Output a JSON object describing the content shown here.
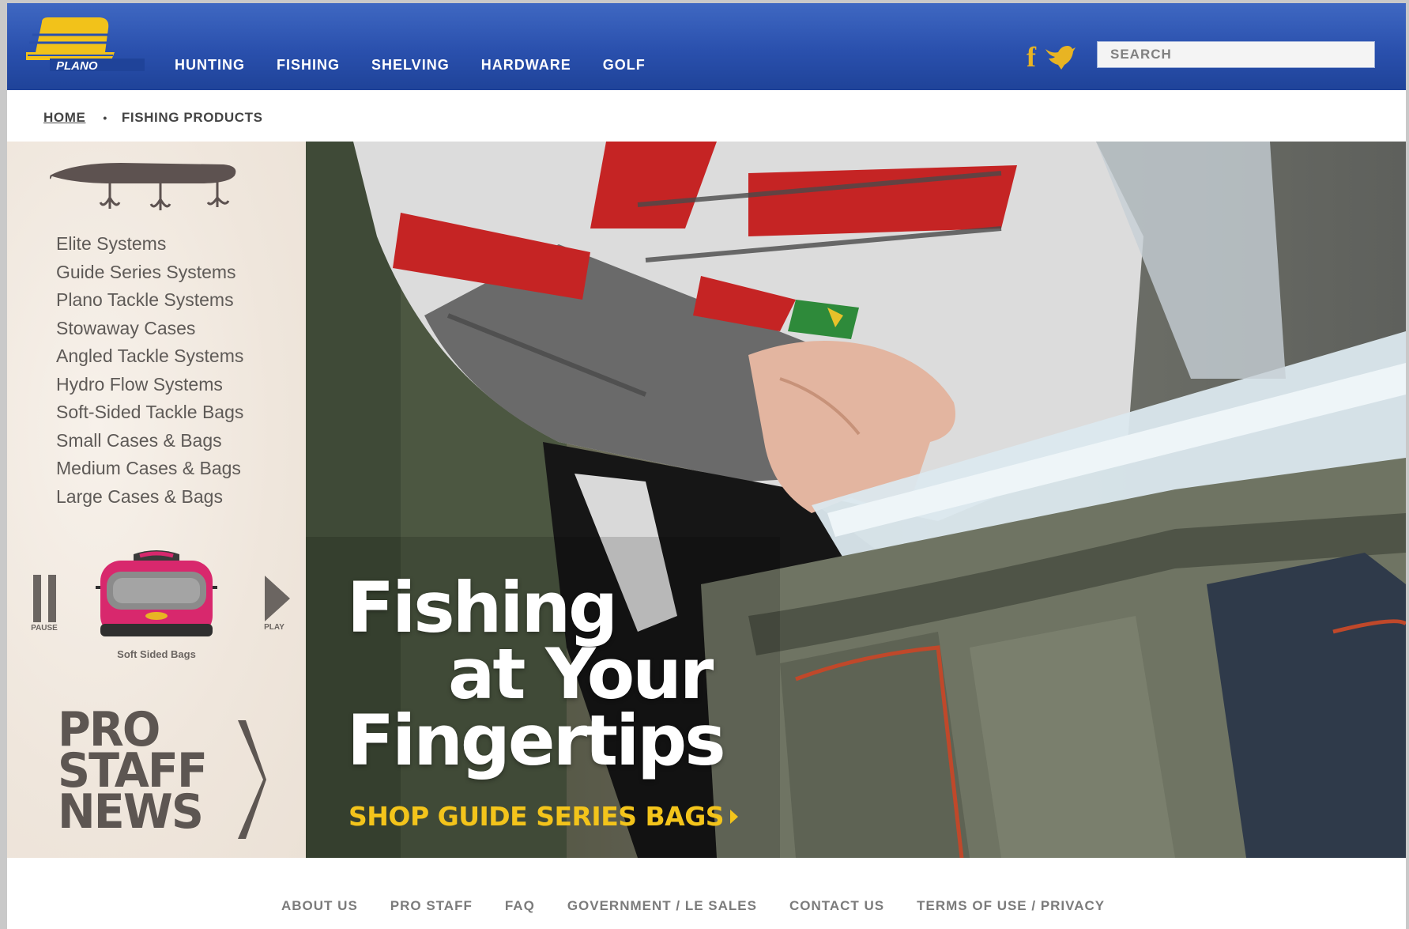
{
  "header": {
    "logo_text": "PLANO",
    "nav": [
      "HUNTING",
      "FISHING",
      "SHELVING",
      "HARDWARE",
      "GOLF"
    ],
    "social": {
      "facebook_glyph": "f",
      "facebook_icon": "facebook-icon",
      "twitter_icon": "twitter-bird-icon"
    },
    "search": {
      "placeholder": "SEARCH",
      "value": ""
    }
  },
  "breadcrumb": {
    "home": "HOME",
    "separator": "•",
    "current": "FISHING PRODUCTS"
  },
  "sidebar": {
    "categories": [
      "Elite Systems",
      "Guide Series Systems",
      "Plano Tackle Systems",
      "Stowaway Cases",
      "Angled Tackle Systems",
      "Hydro Flow Systems",
      "Soft-Sided Tackle Bags",
      "Small Cases & Bags",
      "Medium Cases & Bags",
      "Large Cases & Bags"
    ],
    "carousel": {
      "pause_label": "PAUSE",
      "play_label": "PLAY",
      "caption": "Soft Sided Bags"
    },
    "promo": {
      "line1": "PRO",
      "line2": "STAFF",
      "line3": "NEWS"
    }
  },
  "hero": {
    "title_line1": "Fishing",
    "title_line2": "at Your",
    "title_line3": "Fingertips",
    "cta": "SHOP GUIDE SERIES BAGS"
  },
  "footer": {
    "links": [
      "ABOUT US",
      "PRO STAFF",
      "FAQ",
      "GOVERNMENT / LE SALES",
      "CONTACT US",
      "TERMS OF USE / PRIVACY"
    ]
  },
  "colors": {
    "header_blue": "#2a50ad",
    "logo_yellow": "#f2c21a",
    "cta_yellow": "#f3c41b",
    "sidebar_text": "#5e5a57"
  }
}
